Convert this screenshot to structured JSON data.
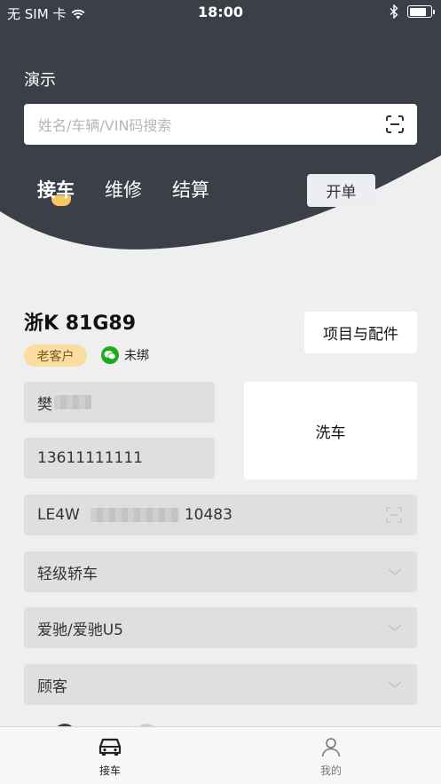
{
  "status_bar": {
    "carrier": "无 SIM 卡",
    "time": "18:00"
  },
  "header": {
    "title": "演示",
    "search": {
      "placeholder": "姓名/车辆/VIN码搜索"
    },
    "tabs": [
      {
        "label": "接车",
        "active": true
      },
      {
        "label": "维修",
        "active": false
      },
      {
        "label": "结算",
        "active": false
      }
    ],
    "open_order_label": "开单"
  },
  "vehicle": {
    "plate": "浙K 81G89",
    "parts_button": "项目与配件",
    "customer_badge": "老客户",
    "wechat_status": "未绑",
    "name_prefix": "樊",
    "phone": "13611111111",
    "vin_prefix": "LE4W",
    "vin_suffix": "10483",
    "vehicle_type": "轻级轿车",
    "model": "爱驰/爱驰U5",
    "customer_type": "顾客",
    "service_tile": "洗车"
  },
  "colors": {
    "header": "#3b3f48",
    "accent": "#f6c760",
    "badge_bg": "#fbdca1",
    "wechat": "#1aad19"
  },
  "tab_bar": [
    {
      "label": "接车",
      "icon": "car-icon",
      "active": true
    },
    {
      "label": "我的",
      "icon": "person-icon",
      "active": false
    }
  ]
}
